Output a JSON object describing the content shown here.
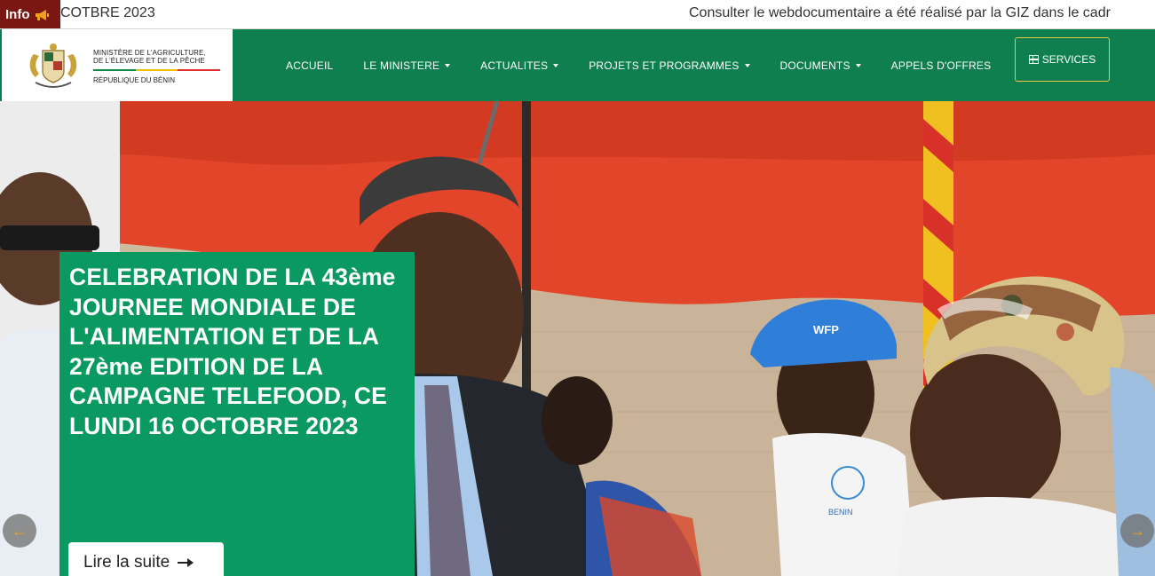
{
  "ticker": {
    "badge_label": "Info",
    "badge_icon": "megaphone-icon",
    "text_left": "COTBRE 2023",
    "text_right": "Consulter le webdocumentaire a été réalisé par la GIZ dans le cadr"
  },
  "header": {
    "ministry_line1": "MINISTÈRE DE L'AGRICULTURE,",
    "ministry_line2": "DE L'ÉLEVAGE ET DE LA PÊCHE",
    "republic": "RÉPUBLIQUE DU BÉNIN",
    "nav": [
      {
        "label": "ACCUEIL",
        "dropdown": false
      },
      {
        "label": "LE MINISTERE",
        "dropdown": true
      },
      {
        "label": "ACTUALITES",
        "dropdown": true
      },
      {
        "label": "PROJETS ET PROGRAMMES",
        "dropdown": true
      },
      {
        "label": "DOCUMENTS",
        "dropdown": true
      },
      {
        "label": "APPELS D'OFFRES",
        "dropdown": false
      }
    ],
    "services_label": "SERVICES",
    "services_icon": "grid-icon"
  },
  "hero": {
    "caption_title": "CELEBRATION DE LA 43ème JOURNEE MONDIALE DE L'ALIMENTATION ET DE LA 27ème EDITION DE LA CAMPAGNE TELEFOOD, CE LUNDI 16 OCTOBRE 2023",
    "read_more_label": "Lire la suite",
    "cap_label": "WFP",
    "shirt_label": "BENIN",
    "prev_icon": "arrow-left-icon",
    "next_icon": "arrow-right-icon"
  },
  "colors": {
    "brand_green": "#0f7f4f",
    "caption_green": "#0a9961",
    "info_red": "#7a1712",
    "services_border": "#e8c840",
    "arrow_orange": "#f0a020"
  }
}
